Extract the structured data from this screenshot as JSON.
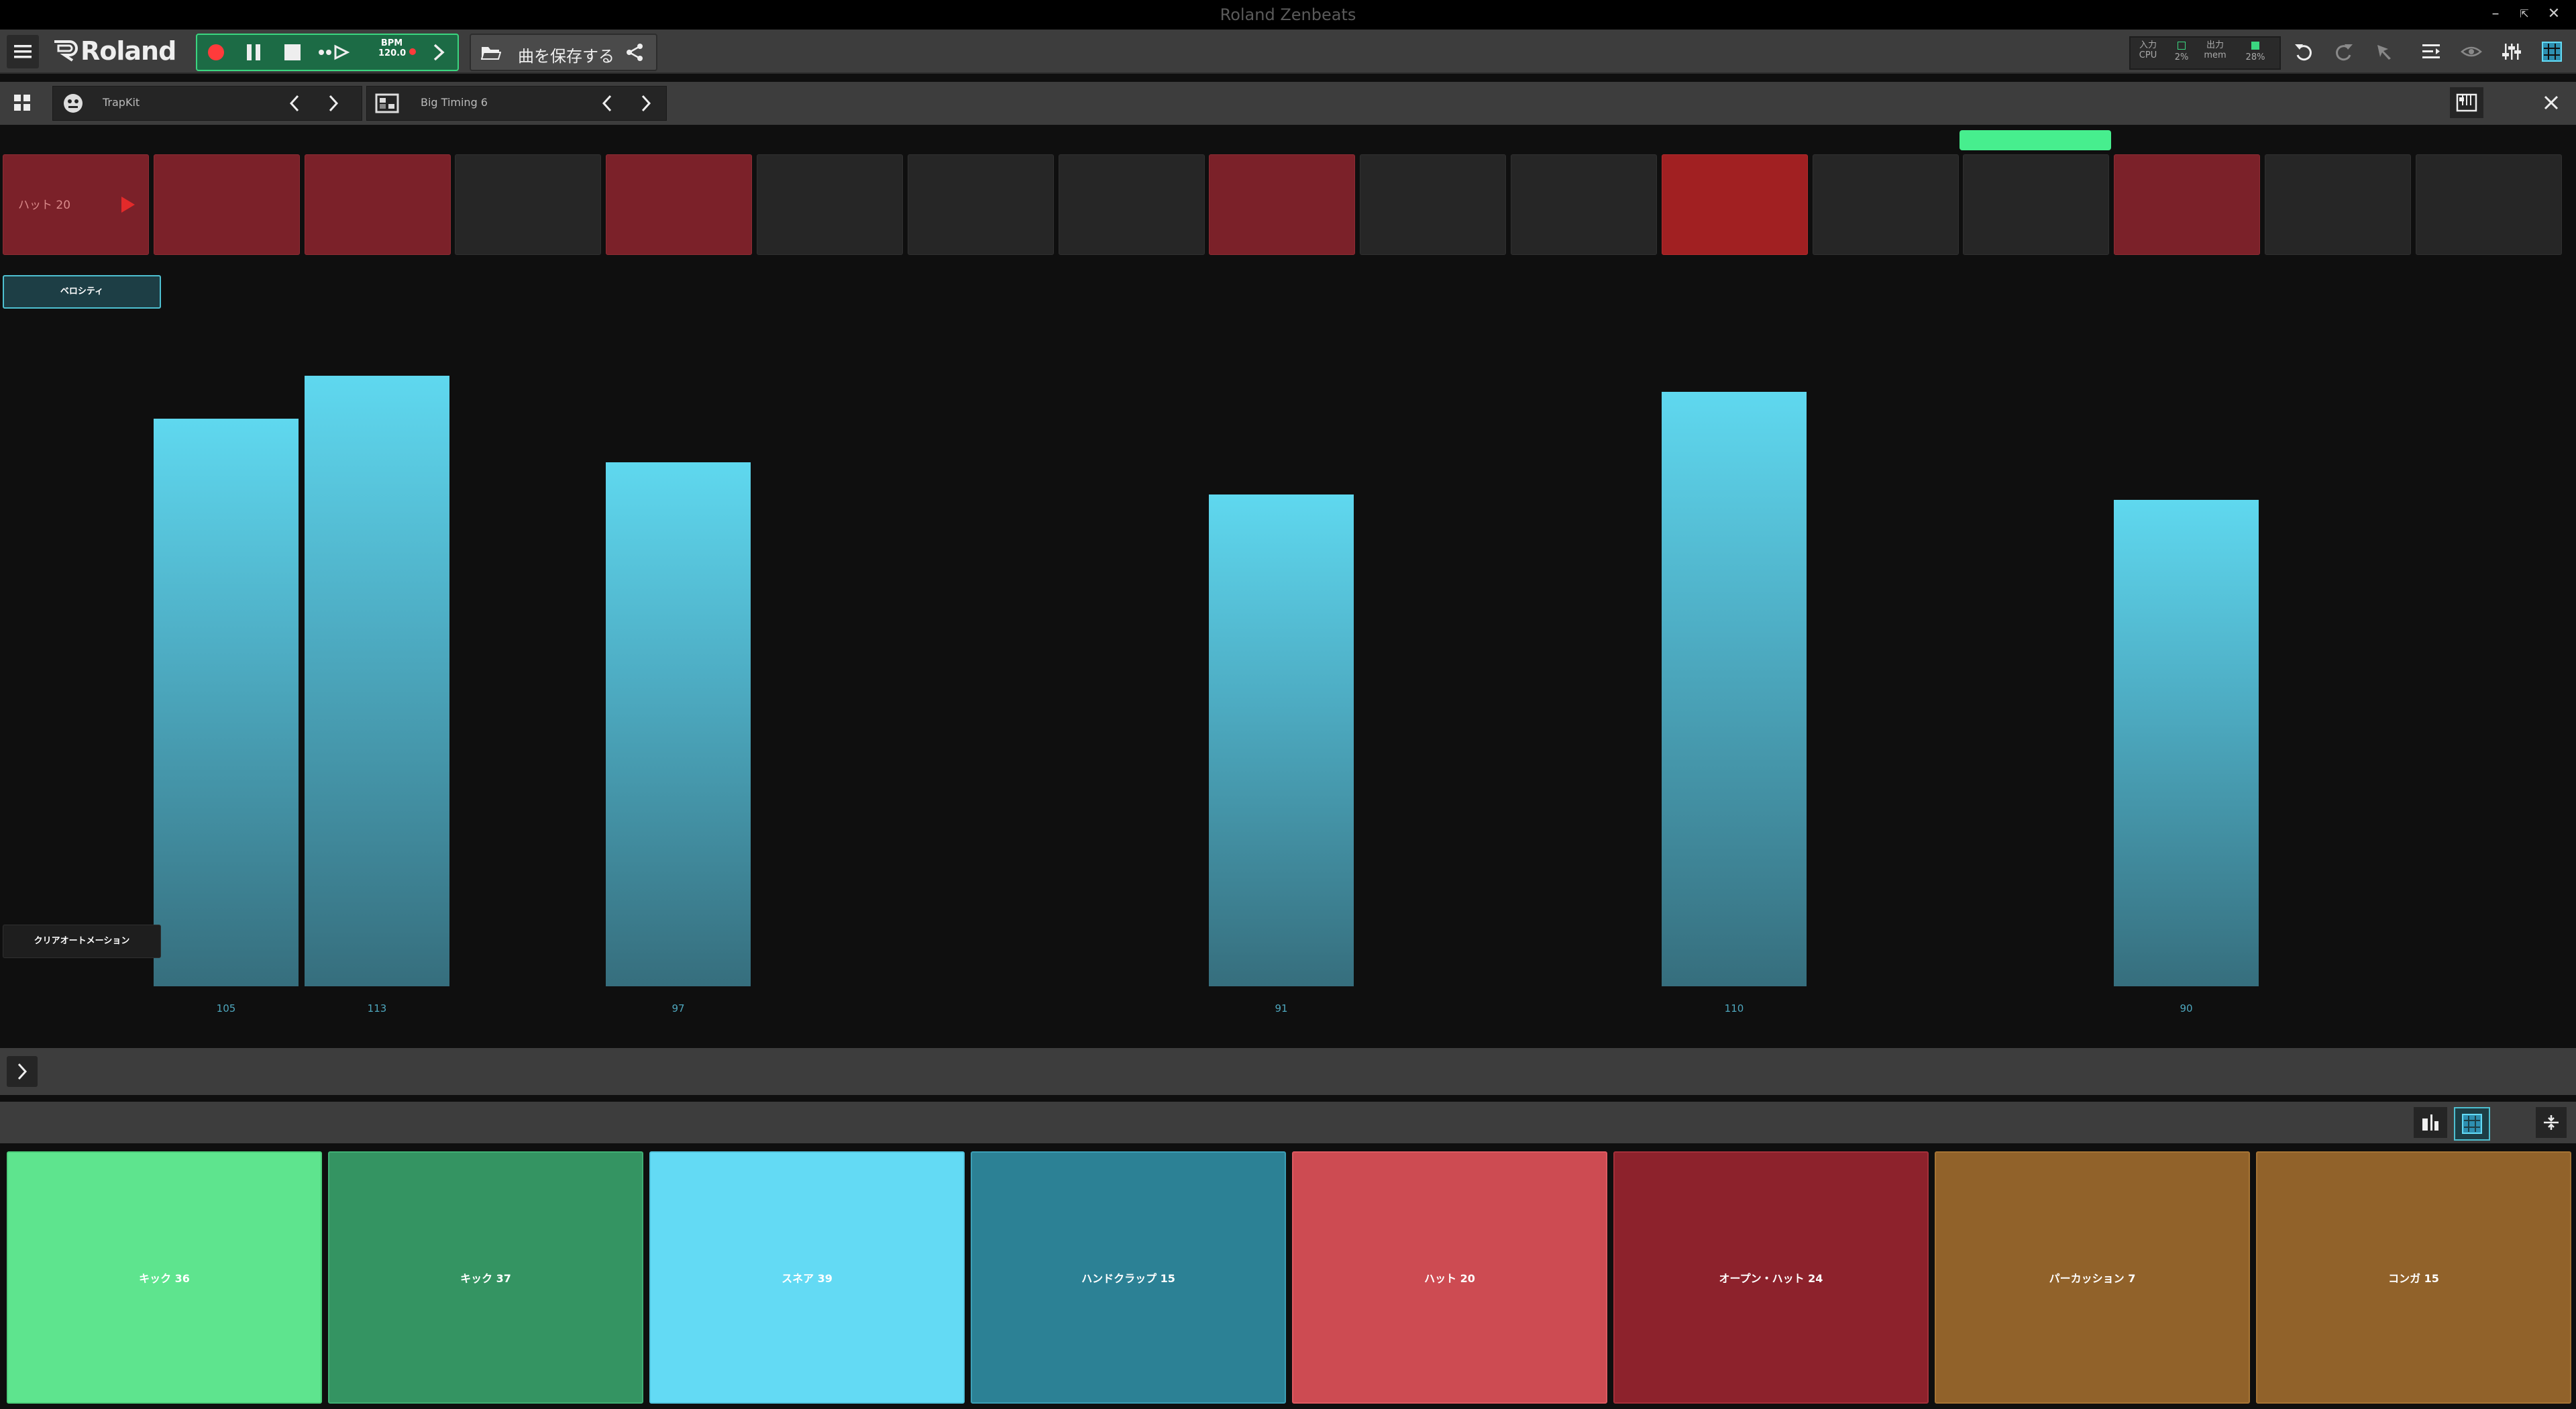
{
  "window": {
    "title": "Roland Zenbeats",
    "min": "–",
    "restore": "⇱",
    "close": "✕"
  },
  "toolbar": {
    "logo": "Roland",
    "bpm_label": "BPM",
    "bpm_value": "120.0",
    "save_label": "曲を保存する",
    "meters": {
      "input_label": "入力",
      "cpu_label": "CPU",
      "cpu_value": "2%",
      "output_label": "出力",
      "mem_label": "mem",
      "mem_value": "28%"
    }
  },
  "subbar": {
    "kit_name": "TrapKit",
    "pattern_name": "Big Timing 6"
  },
  "sequencer": {
    "track_label": "ハット 20",
    "steps": [
      "on",
      "on",
      "on",
      "off",
      "on",
      "off",
      "off",
      "off",
      "on",
      "off",
      "off",
      "accent",
      "off",
      "off",
      "on",
      "off",
      "off"
    ],
    "playhead_step": 13
  },
  "velocity": {
    "mode_label": "ベロシティ",
    "clear_label": "クリアオートメーション",
    "max": 127,
    "bars": [
      {
        "step": 1,
        "value": 105,
        "label": "105"
      },
      {
        "step": 2,
        "value": 113,
        "label": "113"
      },
      {
        "step": 4,
        "value": 97,
        "label": "97"
      },
      {
        "step": 8,
        "value": 91,
        "label": "91"
      },
      {
        "step": 11,
        "value": 110,
        "label": "110"
      },
      {
        "step": 14,
        "value": 90,
        "label": "90"
      }
    ]
  },
  "pads": [
    {
      "label": "キック 36",
      "color": "#5ee48e",
      "border": "#4ccf7b"
    },
    {
      "label": "キック 37",
      "color": "#349462",
      "border": "#3fb074"
    },
    {
      "label": "スネア 39",
      "color": "#63daf4",
      "border": "#52c6e0"
    },
    {
      "label": "ハンドクラップ 15",
      "color": "#2c8195",
      "border": "#3c9fb6"
    },
    {
      "label": "ハット 20",
      "color": "#cd4b52",
      "border": "#de5a61"
    },
    {
      "label": "オープン・ハット 24",
      "color": "#8d222c",
      "border": "#a5303a"
    },
    {
      "label": "パーカッション 7",
      "color": "#91622a",
      "border": "#a67434"
    },
    {
      "label": "コンガ 15",
      "color": "#91622a",
      "border": "#a67434"
    }
  ]
}
